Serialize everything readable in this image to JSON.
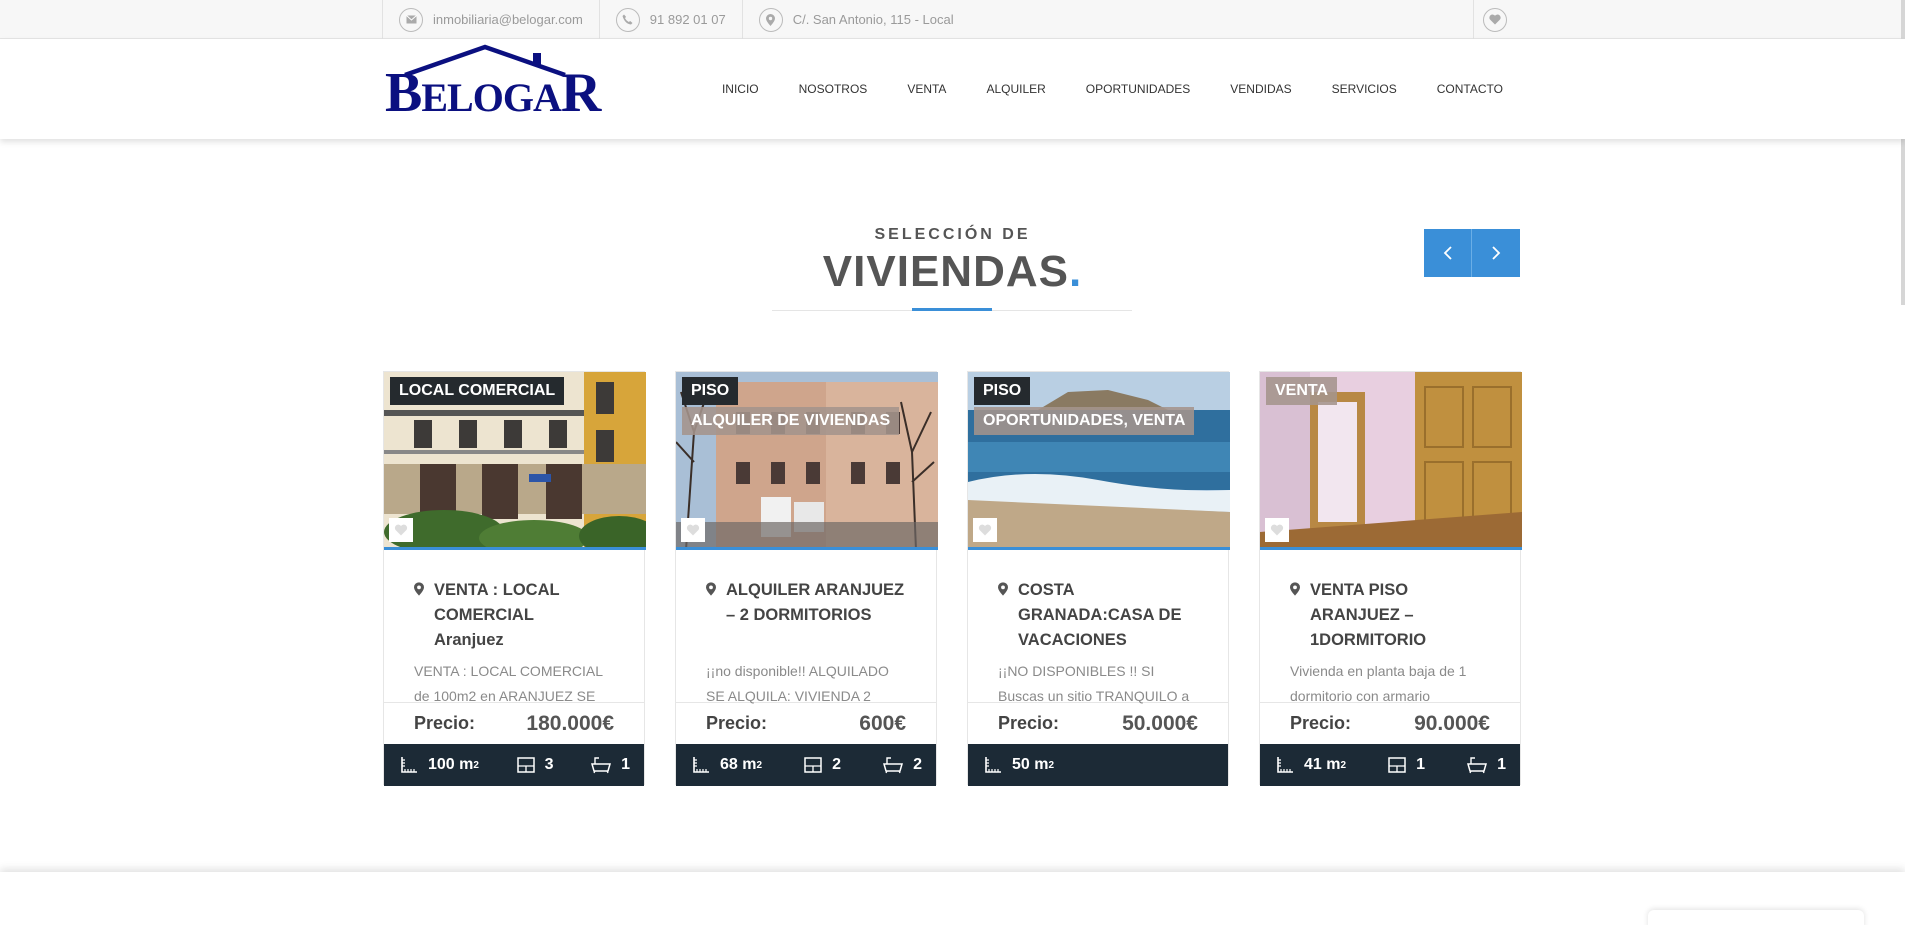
{
  "topbar": {
    "email": "inmobiliaria@belogar.com",
    "phone": "91 892 01 07",
    "address": "C/. San Antonio, 115 - Local"
  },
  "logo": {
    "big1": "B",
    "small1": "ELOGA",
    "big2": "R"
  },
  "nav": [
    "INICIO",
    "NOSOTROS",
    "VENTA",
    "ALQUILER",
    "OPORTUNIDADES",
    "VENDIDAS",
    "SERVICIOS",
    "CONTACTO"
  ],
  "section": {
    "subtitle": "SELECCIÓN DE",
    "title": "VIVIENDAS",
    "title_dot": "."
  },
  "colors": {
    "accent": "#3a8fd8",
    "footer_dark": "#1c2a36",
    "logo_blue": "#0b1080"
  },
  "price_label": "Precio:",
  "area_unit": "m",
  "area_sup": "2",
  "listings": [
    {
      "badges": [
        "LOCAL COMERCIAL"
      ],
      "title": "VENTA : LOCAL COMERCIAL",
      "title_sub": "Aranjuez",
      "desc": "VENTA : LOCAL COMERCIAL de 100m2  en ARANJUEZ SE",
      "price": "180.000€",
      "area": "100",
      "rooms": "3",
      "baths": "1"
    },
    {
      "badges": [
        "PISO",
        "ALQUILER DE VIVIENDAS"
      ],
      "title": "ALQUILER ARANJUEZ – 2 DORMITORIOS",
      "title_sub": "",
      "desc": "¡¡no disponible!! ALQUILADO SE ALQUILA: VIVIENDA 2",
      "price": "600€",
      "area": "68",
      "rooms": "2",
      "baths": "2"
    },
    {
      "badges": [
        "PISO",
        "OPORTUNIDADES, VENTA"
      ],
      "title": "COSTA GRANADA:CASA DE VACACIONES",
      "title_sub": "",
      "desc": "¡¡NO DISPONIBLES !! SI Buscas un sitio TRANQUILO a",
      "price": "50.000€",
      "area": "50",
      "rooms": "",
      "baths": ""
    },
    {
      "badges": [
        "VENTA"
      ],
      "title": "VENTA PISO ARANJUEZ – 1DORMITORIO",
      "title_sub": "",
      "desc": "Vivienda en planta baja de 1 dormitorio con armario",
      "price": "90.000€",
      "area": "41",
      "rooms": "1",
      "baths": "1"
    }
  ]
}
